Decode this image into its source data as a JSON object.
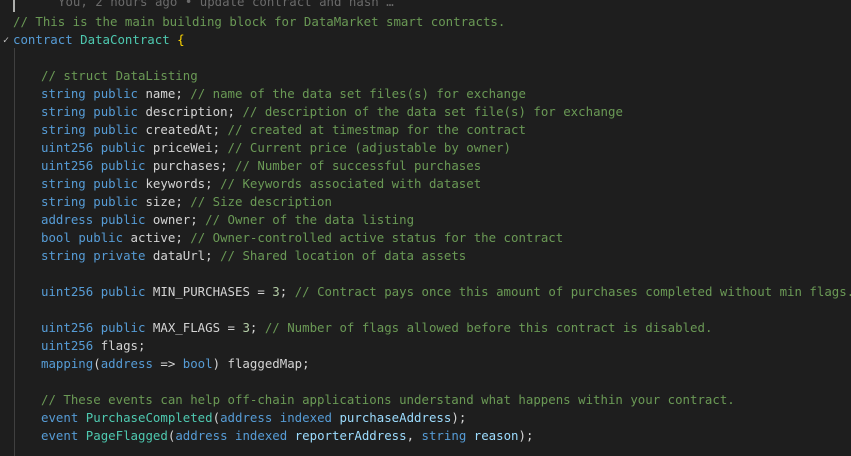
{
  "blame": {
    "text": "You, 2 hours ago • update contract and hash …"
  },
  "fold": {
    "icon": "✓"
  },
  "lines": [
    [
      {
        "t": "// This is the main building block for DataMarket smart contracts.",
        "k": "comment"
      }
    ],
    [
      {
        "t": "contract",
        "k": "keyword"
      },
      {
        "t": " ",
        "k": "punct"
      },
      {
        "t": "DataContract",
        "k": "type"
      },
      {
        "t": " ",
        "k": "punct"
      },
      {
        "t": "{",
        "k": "brace"
      }
    ],
    [],
    [
      {
        "t": "// struct DataListing",
        "k": "comment"
      }
    ],
    [
      {
        "t": "string",
        "k": "keyword"
      },
      {
        "t": " ",
        "k": "punct"
      },
      {
        "t": "public",
        "k": "keyword"
      },
      {
        "t": " ",
        "k": "punct"
      },
      {
        "t": "name",
        "k": "ident"
      },
      {
        "t": "; ",
        "k": "punct"
      },
      {
        "t": "// name of the data set files(s) for exchange",
        "k": "comment"
      }
    ],
    [
      {
        "t": "string",
        "k": "keyword"
      },
      {
        "t": " ",
        "k": "punct"
      },
      {
        "t": "public",
        "k": "keyword"
      },
      {
        "t": " ",
        "k": "punct"
      },
      {
        "t": "description",
        "k": "ident"
      },
      {
        "t": "; ",
        "k": "punct"
      },
      {
        "t": "// description of the data set file(s) for exchange",
        "k": "comment"
      }
    ],
    [
      {
        "t": "string",
        "k": "keyword"
      },
      {
        "t": " ",
        "k": "punct"
      },
      {
        "t": "public",
        "k": "keyword"
      },
      {
        "t": " ",
        "k": "punct"
      },
      {
        "t": "createdAt",
        "k": "ident"
      },
      {
        "t": "; ",
        "k": "punct"
      },
      {
        "t": "// created at timestmap for the contract",
        "k": "comment"
      }
    ],
    [
      {
        "t": "uint256",
        "k": "keyword"
      },
      {
        "t": " ",
        "k": "punct"
      },
      {
        "t": "public",
        "k": "keyword"
      },
      {
        "t": " ",
        "k": "punct"
      },
      {
        "t": "priceWei",
        "k": "ident"
      },
      {
        "t": "; ",
        "k": "punct"
      },
      {
        "t": "// Current price (adjustable by owner)",
        "k": "comment"
      }
    ],
    [
      {
        "t": "uint256",
        "k": "keyword"
      },
      {
        "t": " ",
        "k": "punct"
      },
      {
        "t": "public",
        "k": "keyword"
      },
      {
        "t": " ",
        "k": "punct"
      },
      {
        "t": "purchases",
        "k": "ident"
      },
      {
        "t": "; ",
        "k": "punct"
      },
      {
        "t": "// Number of successful purchases",
        "k": "comment"
      }
    ],
    [
      {
        "t": "string",
        "k": "keyword"
      },
      {
        "t": " ",
        "k": "punct"
      },
      {
        "t": "public",
        "k": "keyword"
      },
      {
        "t": " ",
        "k": "punct"
      },
      {
        "t": "keywords",
        "k": "ident"
      },
      {
        "t": "; ",
        "k": "punct"
      },
      {
        "t": "// Keywords associated with dataset",
        "k": "comment"
      }
    ],
    [
      {
        "t": "string",
        "k": "keyword"
      },
      {
        "t": " ",
        "k": "punct"
      },
      {
        "t": "public",
        "k": "keyword"
      },
      {
        "t": " ",
        "k": "punct"
      },
      {
        "t": "size",
        "k": "ident"
      },
      {
        "t": "; ",
        "k": "punct"
      },
      {
        "t": "// Size description",
        "k": "comment"
      }
    ],
    [
      {
        "t": "address",
        "k": "keyword"
      },
      {
        "t": " ",
        "k": "punct"
      },
      {
        "t": "public",
        "k": "keyword"
      },
      {
        "t": " ",
        "k": "punct"
      },
      {
        "t": "owner",
        "k": "ident"
      },
      {
        "t": "; ",
        "k": "punct"
      },
      {
        "t": "// Owner of the data listing",
        "k": "comment"
      }
    ],
    [
      {
        "t": "bool",
        "k": "keyword"
      },
      {
        "t": " ",
        "k": "punct"
      },
      {
        "t": "public",
        "k": "keyword"
      },
      {
        "t": " ",
        "k": "punct"
      },
      {
        "t": "active",
        "k": "ident"
      },
      {
        "t": "; ",
        "k": "punct"
      },
      {
        "t": "// Owner-controlled active status for the contract",
        "k": "comment"
      }
    ],
    [
      {
        "t": "string",
        "k": "keyword"
      },
      {
        "t": " ",
        "k": "punct"
      },
      {
        "t": "private",
        "k": "keyword"
      },
      {
        "t": " ",
        "k": "punct"
      },
      {
        "t": "dataUrl",
        "k": "ident"
      },
      {
        "t": "; ",
        "k": "punct"
      },
      {
        "t": "// Shared location of data assets",
        "k": "comment"
      }
    ],
    [],
    [
      {
        "t": "uint256",
        "k": "keyword"
      },
      {
        "t": " ",
        "k": "punct"
      },
      {
        "t": "public",
        "k": "keyword"
      },
      {
        "t": " ",
        "k": "punct"
      },
      {
        "t": "MIN_PURCHASES",
        "k": "ident"
      },
      {
        "t": " = ",
        "k": "punct"
      },
      {
        "t": "3",
        "k": "num"
      },
      {
        "t": "; ",
        "k": "punct"
      },
      {
        "t": "// Contract pays once this amount of purchases completed without min flags.",
        "k": "comment"
      }
    ],
    [],
    [
      {
        "t": "uint256",
        "k": "keyword"
      },
      {
        "t": " ",
        "k": "punct"
      },
      {
        "t": "public",
        "k": "keyword"
      },
      {
        "t": " ",
        "k": "punct"
      },
      {
        "t": "MAX_FLAGS",
        "k": "ident"
      },
      {
        "t": " = ",
        "k": "punct"
      },
      {
        "t": "3",
        "k": "num"
      },
      {
        "t": "; ",
        "k": "punct"
      },
      {
        "t": "// Number of flags allowed before this contract is disabled.",
        "k": "comment"
      }
    ],
    [
      {
        "t": "uint256",
        "k": "keyword"
      },
      {
        "t": " ",
        "k": "punct"
      },
      {
        "t": "flags",
        "k": "ident"
      },
      {
        "t": ";",
        "k": "punct"
      }
    ],
    [
      {
        "t": "mapping",
        "k": "keyword"
      },
      {
        "t": "(",
        "k": "punct"
      },
      {
        "t": "address",
        "k": "keyword"
      },
      {
        "t": " => ",
        "k": "punct"
      },
      {
        "t": "bool",
        "k": "keyword"
      },
      {
        "t": ") ",
        "k": "punct"
      },
      {
        "t": "flaggedMap",
        "k": "ident"
      },
      {
        "t": ";",
        "k": "punct"
      }
    ],
    [],
    [
      {
        "t": "// These events can help off-chain applications understand what happens within your contract.",
        "k": "comment"
      }
    ],
    [
      {
        "t": "event",
        "k": "keyword"
      },
      {
        "t": " ",
        "k": "punct"
      },
      {
        "t": "PurchaseCompleted",
        "k": "func"
      },
      {
        "t": "(",
        "k": "punct"
      },
      {
        "t": "address",
        "k": "keyword"
      },
      {
        "t": " ",
        "k": "punct"
      },
      {
        "t": "indexed",
        "k": "keyword"
      },
      {
        "t": " ",
        "k": "punct"
      },
      {
        "t": "purchaseAddress",
        "k": "var"
      },
      {
        "t": ");",
        "k": "punct"
      }
    ],
    [
      {
        "t": "event",
        "k": "keyword"
      },
      {
        "t": " ",
        "k": "punct"
      },
      {
        "t": "PageFlagged",
        "k": "func"
      },
      {
        "t": "(",
        "k": "punct"
      },
      {
        "t": "address",
        "k": "keyword"
      },
      {
        "t": " ",
        "k": "punct"
      },
      {
        "t": "indexed",
        "k": "keyword"
      },
      {
        "t": " ",
        "k": "punct"
      },
      {
        "t": "reporterAddress",
        "k": "var"
      },
      {
        "t": ", ",
        "k": "punct"
      },
      {
        "t": "string",
        "k": "keyword"
      },
      {
        "t": " ",
        "k": "punct"
      },
      {
        "t": "reason",
        "k": "var"
      },
      {
        "t": ");",
        "k": "punct"
      }
    ]
  ]
}
